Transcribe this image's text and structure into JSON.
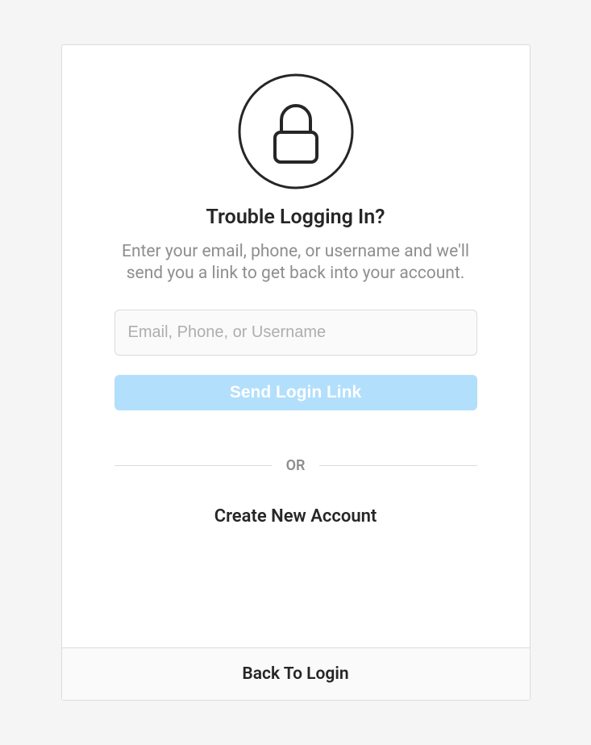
{
  "title": "Trouble Logging In?",
  "subtitle": "Enter your email, phone, or username and we'll send you a link to get back into your account.",
  "input": {
    "placeholder": "Email, Phone, or Username",
    "value": ""
  },
  "buttons": {
    "send": "Send Login Link",
    "createAccount": "Create New Account",
    "backToLogin": "Back To Login"
  },
  "divider": "OR"
}
